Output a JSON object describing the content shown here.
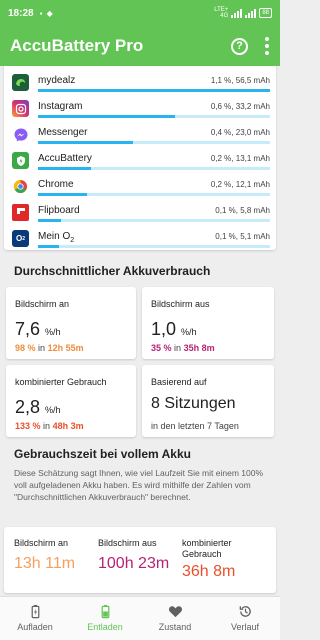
{
  "status_bar": {
    "time": "18:28",
    "battery": "88",
    "network_top": "LTE+",
    "network_bottom": "4G"
  },
  "app_bar": {
    "title": "AccuBattery Pro"
  },
  "apps": [
    {
      "name": "mydealz",
      "percent": "1,1 %",
      "mah": "56,5 mAh",
      "usage": 1.0,
      "icon_color": "#1e5e3a"
    },
    {
      "name": "Instagram",
      "percent": "0,6 %",
      "mah": "33,2 mAh",
      "usage": 0.59,
      "icon_color": "#d6306f"
    },
    {
      "name": "Messenger",
      "percent": "0,4 %",
      "mah": "23,0 mAh",
      "usage": 0.41,
      "icon_color": "#7b5cf5"
    },
    {
      "name": "AccuBattery",
      "percent": "0,2 %",
      "mah": "13,1 mAh",
      "usage": 0.23,
      "icon_color": "#3aa845"
    },
    {
      "name": "Chrome",
      "percent": "0,2 %",
      "mah": "12,1 mAh",
      "usage": 0.21,
      "icon_color": "#e8453c"
    },
    {
      "name": "Flipboard",
      "percent": "0,1 %",
      "mah": "5,8 mAh",
      "usage": 0.1,
      "icon_color": "#e12828"
    },
    {
      "name": "Mein O",
      "name_sub": "2",
      "percent": "0,1 %",
      "mah": "5,1 mAh",
      "usage": 0.09,
      "icon_color": "#0a3a7a"
    }
  ],
  "avg_section": {
    "title": "Durchschnittlicher Akkuverbrauch"
  },
  "tiles": {
    "screen_on": {
      "label": "Bildschirm an",
      "value": "7,6",
      "unit": "%/h",
      "pct": "98 %",
      "in": "in",
      "time": "12h 55m"
    },
    "screen_off": {
      "label": "Bildschirm aus",
      "value": "1,0",
      "unit": "%/h",
      "pct": "35 %",
      "in": "in",
      "time": "35h 8m"
    },
    "combined": {
      "label": "kombinierter Gebrauch",
      "value": "2,8",
      "unit": "%/h",
      "pct": "133 %",
      "in": "in",
      "time": "48h 3m"
    },
    "based_on": {
      "label": "Basierend auf",
      "value": "8 Sitzungen",
      "sub": "in den letzten 7 Tagen"
    }
  },
  "runtime_section": {
    "title": "Gebrauchszeit bei vollem Akku",
    "description": "Diese Schätzung sagt Ihnen, wie viel Laufzeit Sie mit einem 100% voll aufgeladenen Akku haben. Es wird mithilfe der Zahlen vom \"Durchschnittlichen Akkuverbrauch\" berechnet.",
    "screen_on": {
      "label": "Bildschirm an",
      "value": "13h 11m",
      "color": "#f6a05f"
    },
    "screen_off": {
      "label": "Bildschirm aus",
      "value": "100h 23m",
      "color": "#b72374"
    },
    "combined": {
      "label": "kombinierter Gebrauch",
      "value": "36h 8m",
      "color": "#e8502b"
    }
  },
  "bottom_nav": [
    {
      "label": "Aufladen",
      "icon": "battery-charging-icon"
    },
    {
      "label": "Entladen",
      "icon": "battery-discharging-icon",
      "active": true
    },
    {
      "label": "Zustand",
      "icon": "heart-icon"
    },
    {
      "label": "Verlauf",
      "icon": "history-icon"
    }
  ],
  "colors": {
    "primary": "#62c454",
    "bar_fill": "#29b3ef",
    "bar_track": "#c6ebfa",
    "orange": "#f08c3a",
    "purple": "#b72374",
    "red": "#e8502b"
  }
}
